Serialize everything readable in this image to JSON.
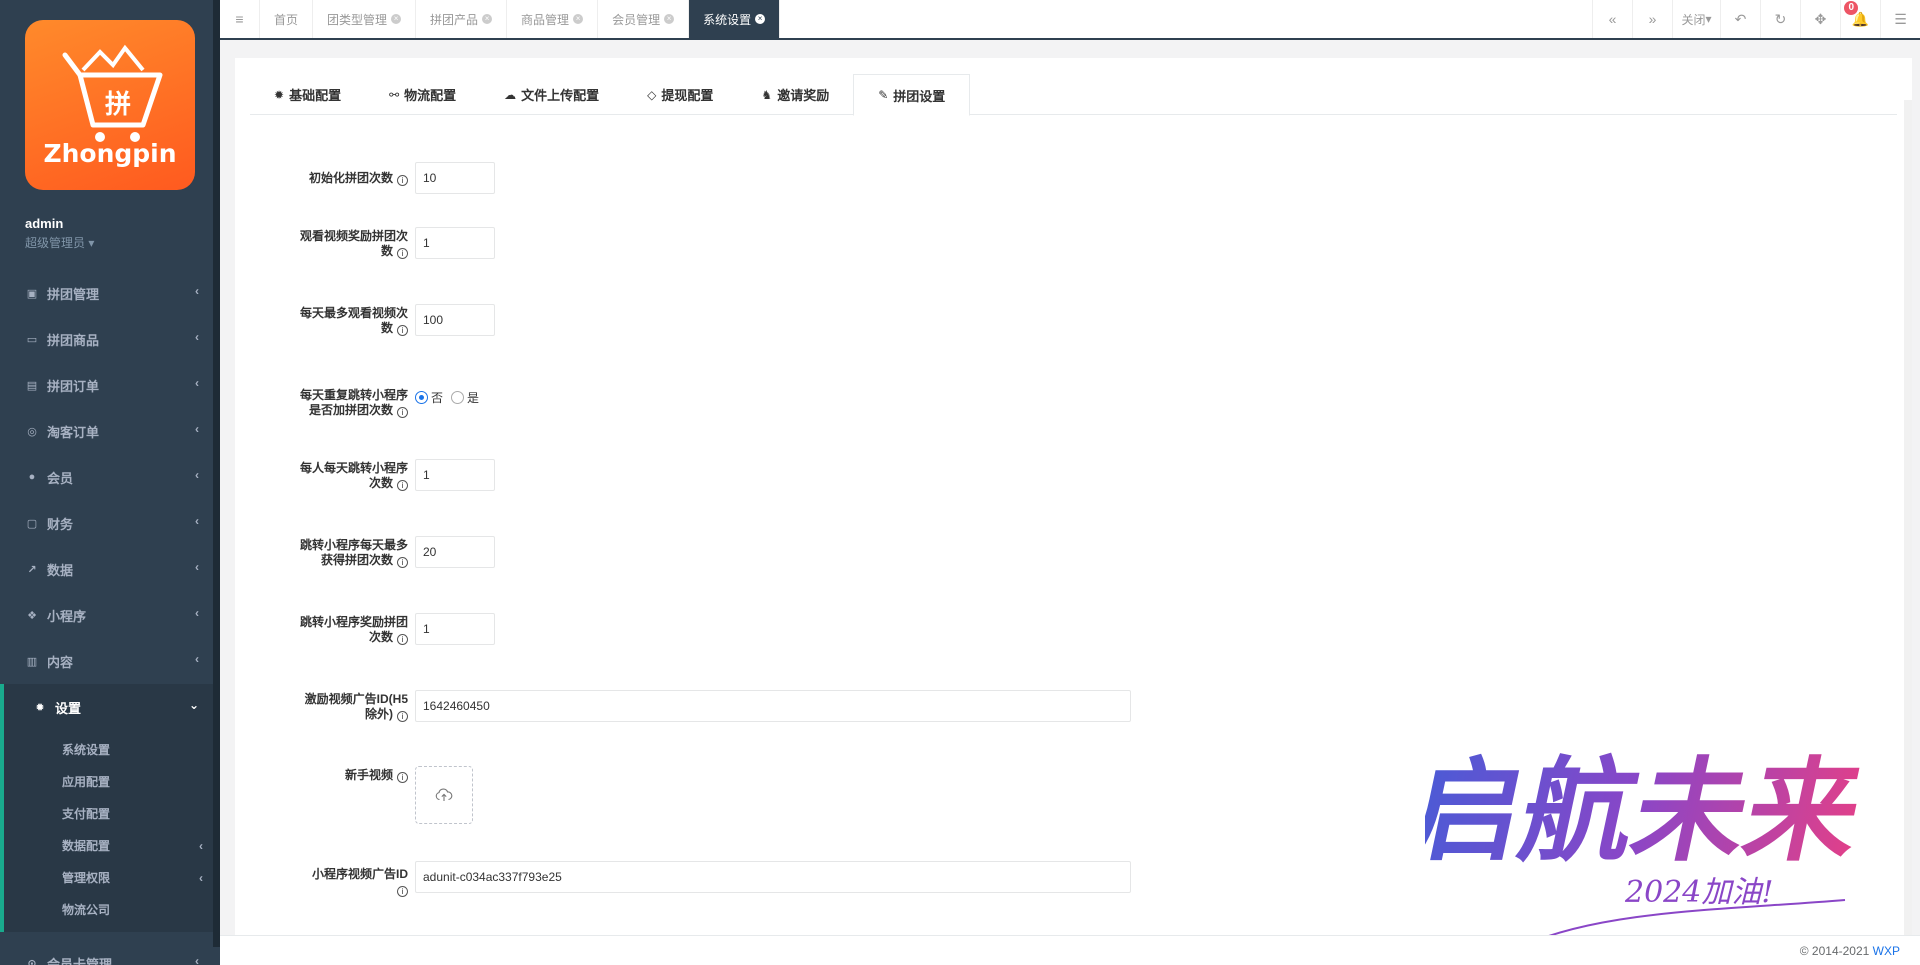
{
  "brand": {
    "logo_text": "Zhongpin",
    "logo_glyph": "拼",
    "accent": "#ff6a21"
  },
  "user": {
    "name": "admin",
    "role": "超级管理员"
  },
  "nav": [
    {
      "label": "拼团管理",
      "icon": "train-icon"
    },
    {
      "label": "拼团商品",
      "icon": "laptop-icon"
    },
    {
      "label": "拼团订单",
      "icon": "file-icon"
    },
    {
      "label": "淘客订单",
      "icon": "globe-icon"
    },
    {
      "label": "会员",
      "icon": "user-icon"
    },
    {
      "label": "财务",
      "icon": "money-icon"
    },
    {
      "label": "数据",
      "icon": "chart-icon"
    },
    {
      "label": "小程序",
      "icon": "cubes-icon"
    },
    {
      "label": "内容",
      "icon": "book-icon"
    }
  ],
  "settings_nav": {
    "label": "设置",
    "icon": "gear-icon"
  },
  "settings_sub": [
    {
      "label": "系统设置"
    },
    {
      "label": "应用配置"
    },
    {
      "label": "支付配置"
    },
    {
      "label": "数据配置"
    },
    {
      "label": "管理权限"
    },
    {
      "label": "物流公司"
    }
  ],
  "nav_bottom": {
    "label": "会员卡管理",
    "icon": "card-icon"
  },
  "tabs": [
    {
      "label": "首页"
    },
    {
      "label": "团类型管理"
    },
    {
      "label": "拼团产品"
    },
    {
      "label": "商品管理"
    },
    {
      "label": "会员管理"
    },
    {
      "label": "系统设置"
    }
  ],
  "topbar": {
    "close_label": "关闭",
    "notification_count": "0"
  },
  "settings_tabs": [
    {
      "label": "基础配置",
      "icon": "gear-icon"
    },
    {
      "label": "物流配置",
      "icon": "motorcycle-icon"
    },
    {
      "label": "文件上传配置",
      "icon": "cloud-upload-icon"
    },
    {
      "label": "提现配置",
      "icon": "diamond-icon"
    },
    {
      "label": "邀请奖励",
      "icon": "user-secret-icon"
    },
    {
      "label": "拼团设置",
      "icon": "paint-brush-icon"
    }
  ],
  "form": {
    "init_count": {
      "label": "初始化拼团次数",
      "value": "10"
    },
    "watch_reward": {
      "label_1": "观看视频奖励拼团次",
      "label_2": "数",
      "value": "1"
    },
    "max_watch": {
      "label_1": "每天最多观看视频次",
      "label_2": "数",
      "value": "100"
    },
    "repeat_jump": {
      "label_1": "每天重复跳转小程序",
      "label_2": "是否加拼团次数",
      "option_no": "否",
      "option_yes": "是",
      "selected": "否"
    },
    "daily_jump": {
      "label_1": "每人每天跳转小程序",
      "label_2": "次数",
      "value": "1"
    },
    "jump_max": {
      "label_1": "跳转小程序每天最多",
      "label_2": "获得拼团次数",
      "value": "20"
    },
    "jump_reward": {
      "label_1": "跳转小程序奖励拼团",
      "label_2": "次数",
      "value": "1"
    },
    "ad_id": {
      "label_1": "激励视频广告ID(H5",
      "label_2": "除外)",
      "value": "1642460450"
    },
    "new_video": {
      "label": "新手视频"
    },
    "mini_ad_id": {
      "label": "小程序视频广告ID",
      "value": "adunit-c034ac337f793e25"
    }
  },
  "footer": {
    "copyright": "© 2014-2021",
    "link": "WXP"
  },
  "watermark": {
    "text": "启航未来",
    "sub": "2024加油!"
  }
}
